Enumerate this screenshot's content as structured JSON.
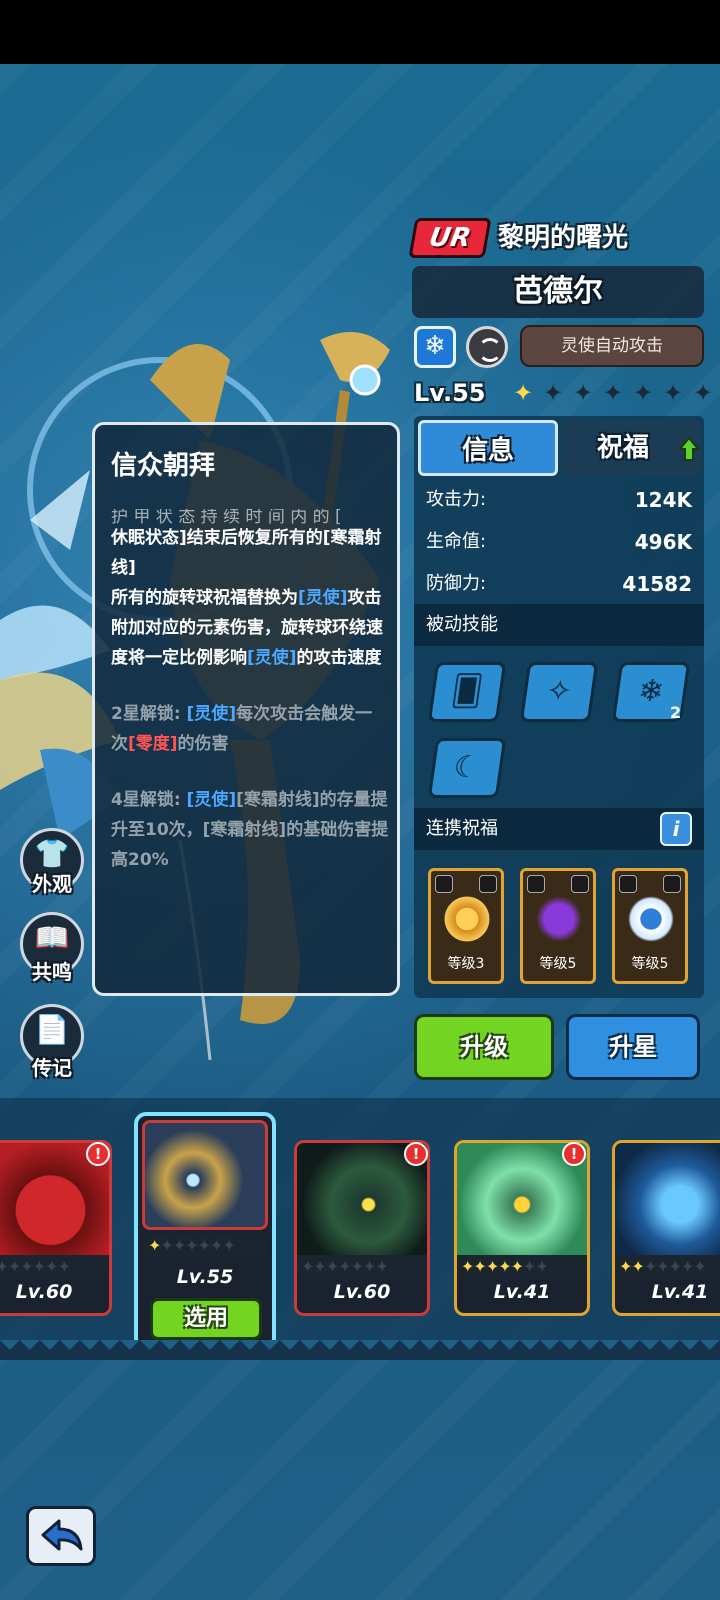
{
  "header": {
    "rarity": "UR",
    "subtitle": "黎明的曙光",
    "name": "芭德尔",
    "auto_attack_label": "灵使自动攻击",
    "level": "Lv.55",
    "stars_total": 7,
    "stars_filled": 1
  },
  "tabs": {
    "info": "信息",
    "bless": "祝福"
  },
  "stats": [
    {
      "label": "攻击力:",
      "value": "124K"
    },
    {
      "label": "生命值:",
      "value": "496K"
    },
    {
      "label": "防御力:",
      "value": "41582"
    }
  ],
  "passive": {
    "title": "被动技能",
    "skill_count": "2"
  },
  "linked_bless": {
    "title": "连携祝福",
    "info_label": "i",
    "cards": [
      {
        "level": "等级3"
      },
      {
        "level": "等级5"
      },
      {
        "level": "等级5"
      }
    ]
  },
  "actions": {
    "upgrade": "升级",
    "star_up": "升星"
  },
  "side": {
    "appearance": "外观",
    "resonance": "共鸣",
    "biography": "传记"
  },
  "tooltip": {
    "title": "信众朝拜",
    "cut_line": "护 甲 状 态 持 续 时 间 内 的 [",
    "p1_a": "休眠状态]结束后恢复所有的[寒霜射线]",
    "p1_b_pre": "所有的旋转球祝福替换为",
    "p1_b_hl": "[灵使]",
    "p1_b_mid": "攻击附加对应的元素伤害，旋转球环绕速度将一定比例影响",
    "p1_b_hl2": "[灵使]",
    "p1_b_post": "的攻击速度",
    "p2_pre": "2星解锁: ",
    "p2_hl": "[灵使]",
    "p2_mid": "每次攻击会触发一次",
    "p2_hl2": "[零度]",
    "p2_post": "的伤害",
    "p3_pre": "4星解锁: ",
    "p3_hl": "[灵使]",
    "p3_post": "[寒霜射线]的存量提升至10次，[寒霜射线]的基础伤害提高20%"
  },
  "roster": [
    {
      "level": "Lv.60",
      "stars": 0,
      "badge": "!"
    },
    {
      "level": "Lv.55",
      "stars": 1,
      "selected": true,
      "select_label": "选用"
    },
    {
      "level": "Lv.60",
      "stars": 0,
      "badge": "!"
    },
    {
      "level": "Lv.41",
      "stars": 5,
      "badge": "!"
    },
    {
      "level": "Lv.41",
      "stars": 2
    }
  ]
}
